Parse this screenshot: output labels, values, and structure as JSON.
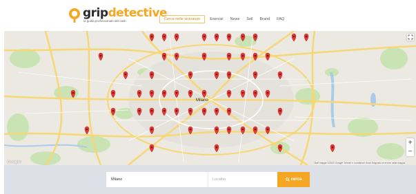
{
  "brand": {
    "name_part1": "grip",
    "name_part2": "detective",
    "tagline": "la guida professionale del cash",
    "accent_color": "#f5a623"
  },
  "nav": {
    "items": [
      {
        "label": "Cerca nelle vicinanze",
        "active": true
      },
      {
        "label": "Esercizi"
      },
      {
        "label": "News"
      },
      {
        "label": "Sell"
      },
      {
        "label": "Brand"
      },
      {
        "label": "FAQ"
      }
    ]
  },
  "map": {
    "city_label": "Milano",
    "attribution": "Dati mappa ©2020 Google  Termini e condizioni d'uso  Segnala un errore nella mappa",
    "google_label": "Google",
    "zoom_in": "+",
    "zoom_out": "−",
    "marker_color": "#e53935",
    "marker_count": 59
  },
  "search": {
    "what_value": "Milano",
    "where_placeholder": "Località",
    "button_label": "cerca",
    "button_icon": "search-icon"
  }
}
